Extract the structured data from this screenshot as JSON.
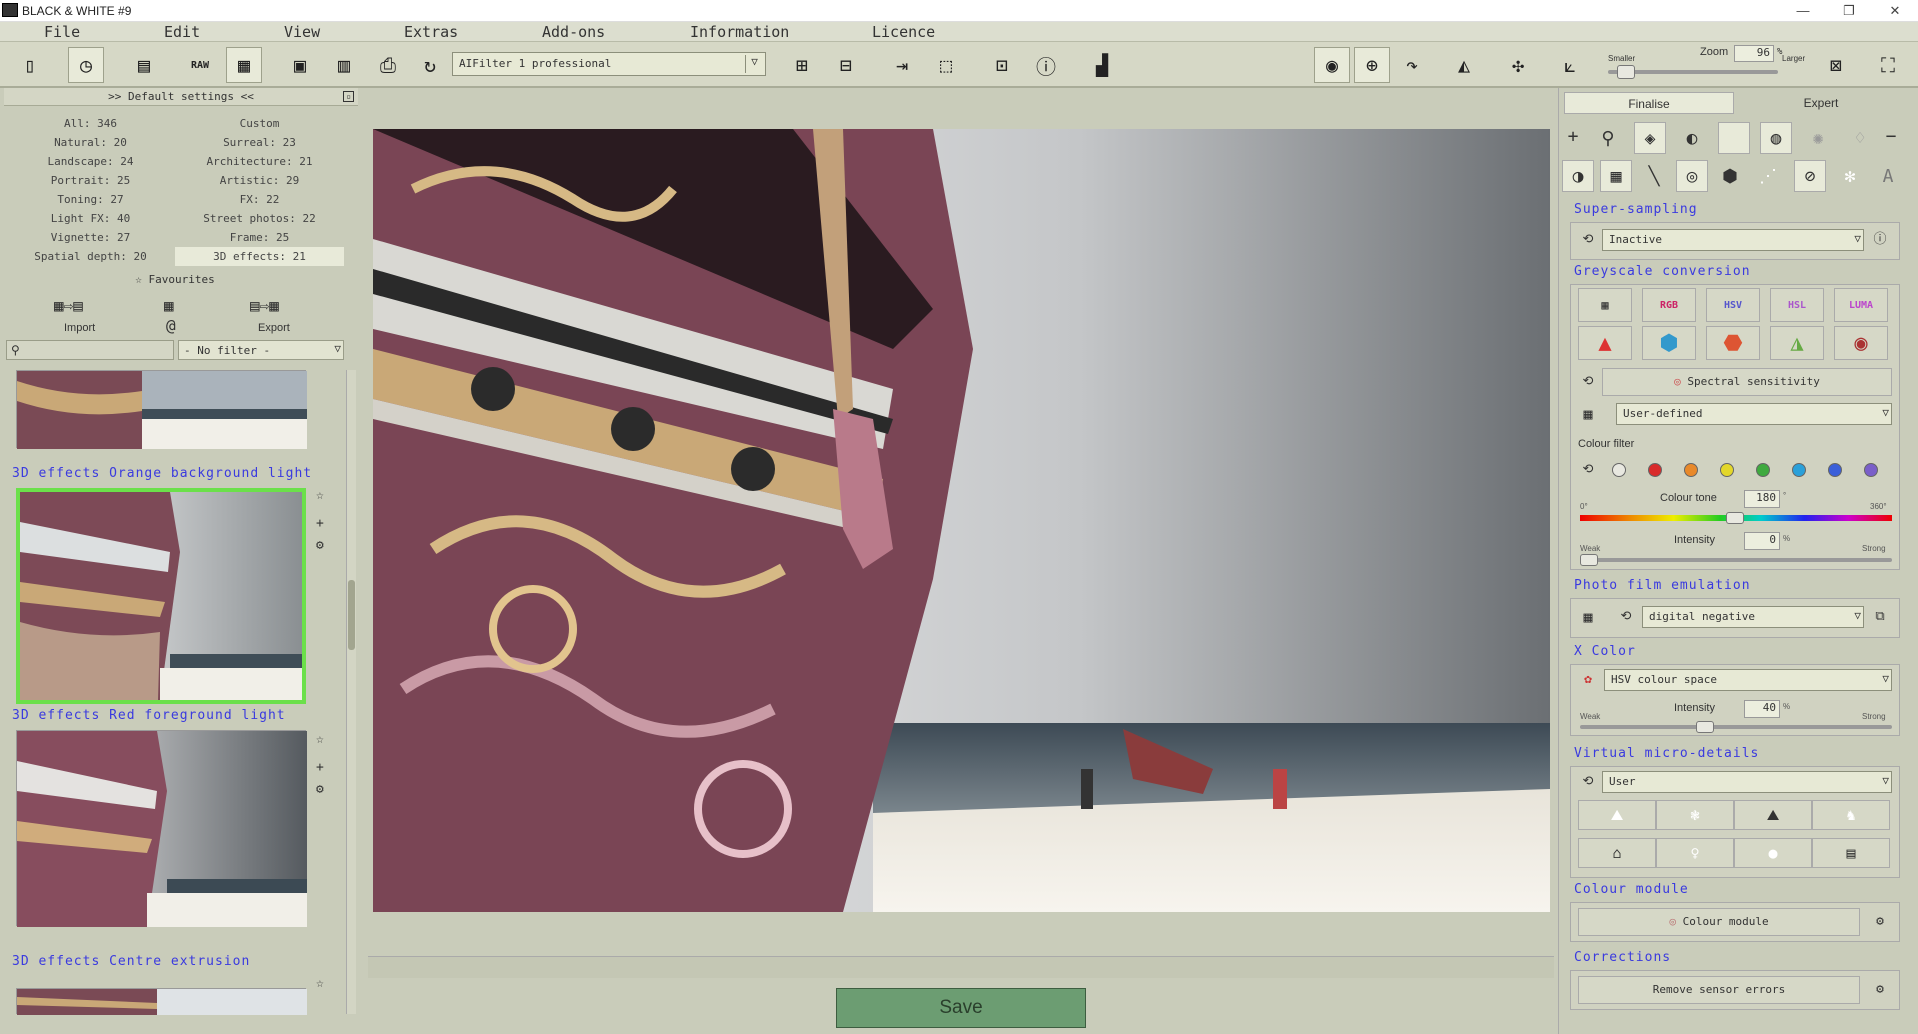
{
  "window": {
    "title": "BLACK & WHITE #9",
    "minimize": "—",
    "maximize": "❐",
    "close": "✕"
  },
  "menu": [
    "File",
    "Edit",
    "View",
    "Extras",
    "Add-ons",
    "Information",
    "Licence"
  ],
  "toolbar": {
    "ai_filter": "AIFilter 1 professional",
    "zoom_label": "Zoom",
    "zoom_value": "96",
    "zoom_unit": "%",
    "zoom_level": 0.06,
    "smaller": "Smaller",
    "larger": "Larger"
  },
  "left": {
    "header": ">> Default settings <<",
    "categories": [
      {
        "label": "All: 346"
      },
      {
        "label": "Custom"
      },
      {
        "label": "Natural: 20"
      },
      {
        "label": "Surreal: 23"
      },
      {
        "label": "Landscape: 24"
      },
      {
        "label": "Architecture: 21"
      },
      {
        "label": "Portrait: 25"
      },
      {
        "label": "Artistic: 29"
      },
      {
        "label": "Toning: 27"
      },
      {
        "label": "FX: 22"
      },
      {
        "label": "Light FX: 40"
      },
      {
        "label": "Street photos: 22"
      },
      {
        "label": "Vignette: 27"
      },
      {
        "label": "Frame: 25"
      },
      {
        "label": "Spatial depth: 20"
      },
      {
        "label": "3D effects: 21",
        "selected": true
      }
    ],
    "favourites": "Favourites",
    "import": "Import",
    "export": "Export",
    "at_symbol": "@",
    "no_filter": "- No filter -",
    "presets": [
      {
        "title": "3D effects Orange background light"
      },
      {
        "title": "3D effects Red foreground light"
      },
      {
        "title": "3D effects Centre extrusion"
      }
    ]
  },
  "canvas": {
    "save": "Save"
  },
  "right": {
    "tabs": [
      "Finalise",
      "Expert"
    ],
    "super_sampling": {
      "title": "Super-sampling",
      "value": "Inactive"
    },
    "greyscale": {
      "title": "Greyscale conversion",
      "spectral": "Spectral sensitivity",
      "mode": "User-defined"
    },
    "colour_filter": {
      "label": "Colour filter",
      "colours": [
        "#e8e8e0",
        "#d92b2b",
        "#e8892a",
        "#e3d72a",
        "#3faa3f",
        "#2aa0d9",
        "#3a5fd9",
        "#7a5fc9"
      ],
      "tone_label": "Colour tone",
      "tone_value": "180",
      "tone_unit": "°",
      "tone_min": "0°",
      "tone_max": "360°",
      "intensity_label": "Intensity",
      "intensity_value": "0",
      "intensity_unit": "%",
      "weak": "Weak",
      "strong": "Strong"
    },
    "film": {
      "title": "Photo film emulation",
      "value": "digital negative"
    },
    "xcolor": {
      "title": "X Color",
      "value": "HSV colour space",
      "intensity_label": "Intensity",
      "intensity_value": "40",
      "intensity_unit": "%",
      "weak": "Weak",
      "strong": "Strong"
    },
    "vmd": {
      "title": "Virtual micro-details",
      "value": "User"
    },
    "colour_module": {
      "title": "Colour module",
      "button": "Colour module"
    },
    "corrections": {
      "title": "Corrections",
      "button": "Remove sensor errors"
    }
  },
  "colors": {
    "accent_blue": "#3a3adf",
    "save_green": "#6c9d72",
    "selection_green": "#6be04a"
  }
}
